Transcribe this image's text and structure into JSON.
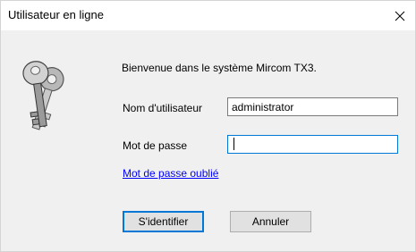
{
  "window": {
    "title": "Utilisateur en ligne",
    "close_glyph": "✕"
  },
  "main": {
    "welcome_text": "Bienvenue dans le système Mircom TX3.",
    "username_label": "Nom d'utilisateur",
    "username_value": "administrator",
    "password_label": "Mot de passe",
    "password_value": "",
    "forgot_link": "Mot de passe oublié"
  },
  "buttons": {
    "login_label": "S'identifier",
    "cancel_label": "Annuler"
  },
  "icons": {
    "keys": "keys-icon",
    "close": "close-icon"
  },
  "colors": {
    "link": "#0000ff",
    "focus_border": "#0078d7",
    "dialog_bg": "#f0f0f0"
  }
}
